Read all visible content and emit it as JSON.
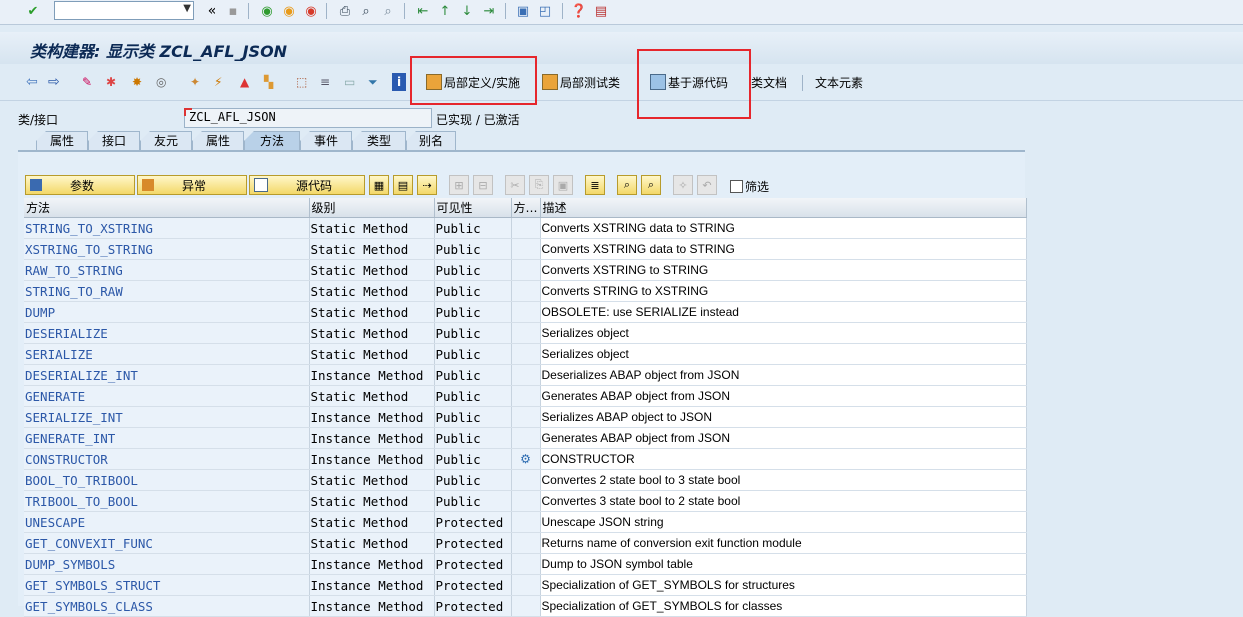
{
  "title": "类构建器: 显示类 ZCL_AFL_JSON",
  "app_toolbar": {
    "local_def": "局部定义/实施",
    "local_test": "局部测试类",
    "source_based": "基于源代码",
    "class_doc": "类文档",
    "text_elements": "文本元素"
  },
  "class": {
    "label": "类/接口",
    "value": "ZCL_AFL_JSON",
    "status": "已实现 / 已激活"
  },
  "tabs": [
    "属性",
    "接口",
    "友元",
    "属性",
    "方法",
    "事件",
    "类型",
    "别名"
  ],
  "active_tab": "方法",
  "grid_toolbar": {
    "params": "参数",
    "exceptions": "异常",
    "source": "源代码",
    "filter": "筛选"
  },
  "columns": [
    "方法",
    "级别",
    "可见性",
    "方…",
    "描述"
  ],
  "rows": [
    {
      "method": "STRING_TO_XSTRING",
      "level": "Static Method",
      "visibility": "Public",
      "desc": "Converts XSTRING data to STRING"
    },
    {
      "method": "XSTRING_TO_STRING",
      "level": "Static Method",
      "visibility": "Public",
      "desc": "Converts XSTRING data to STRING"
    },
    {
      "method": "RAW_TO_STRING",
      "level": "Static Method",
      "visibility": "Public",
      "desc": "Converts XSTRING to STRING"
    },
    {
      "method": "STRING_TO_RAW",
      "level": "Static Method",
      "visibility": "Public",
      "desc": "Converts STRING to XSTRING"
    },
    {
      "method": "DUMP",
      "level": "Static Method",
      "visibility": "Public",
      "desc": "OBSOLETE: use SERIALIZE instead"
    },
    {
      "method": "DESERIALIZE",
      "level": "Static Method",
      "visibility": "Public",
      "desc": "Serializes object"
    },
    {
      "method": "SERIALIZE",
      "level": "Static Method",
      "visibility": "Public",
      "desc": "Serializes object"
    },
    {
      "method": "DESERIALIZE_INT",
      "level": "Instance Method",
      "visibility": "Public",
      "desc": "Deserializes ABAP object from JSON"
    },
    {
      "method": "GENERATE",
      "level": "Static Method",
      "visibility": "Public",
      "desc": "Generates ABAP object from JSON"
    },
    {
      "method": "SERIALIZE_INT",
      "level": "Instance Method",
      "visibility": "Public",
      "desc": "Serializes ABAP object to JSON"
    },
    {
      "method": "GENERATE_INT",
      "level": "Instance Method",
      "visibility": "Public",
      "desc": "Generates ABAP object from JSON"
    },
    {
      "method": "CONSTRUCTOR",
      "level": "Instance Method",
      "visibility": "Public",
      "desc": "CONSTRUCTOR",
      "icon": true
    },
    {
      "method": "BOOL_TO_TRIBOOL",
      "level": "Static Method",
      "visibility": "Public",
      "desc": "Convertes 2 state bool to 3 state bool"
    },
    {
      "method": "TRIBOOL_TO_BOOL",
      "level": "Static Method",
      "visibility": "Public",
      "desc": "Convertes 3 state bool to 2 state bool"
    },
    {
      "method": "UNESCAPE",
      "level": "Static Method",
      "visibility": "Protected",
      "desc": "Unescape JSON string"
    },
    {
      "method": "GET_CONVEXIT_FUNC",
      "level": "Static Method",
      "visibility": "Protected",
      "desc": "Returns name of conversion exit function module"
    },
    {
      "method": "DUMP_SYMBOLS",
      "level": "Instance Method",
      "visibility": "Protected",
      "desc": "Dump to JSON symbol table"
    },
    {
      "method": "GET_SYMBOLS_STRUCT",
      "level": "Instance Method",
      "visibility": "Protected",
      "desc": "Specialization of GET_SYMBOLS for structures"
    },
    {
      "method": "GET_SYMBOLS_CLASS",
      "level": "Instance Method",
      "visibility": "Protected",
      "desc": "Specialization of GET_SYMBOLS for classes"
    }
  ]
}
